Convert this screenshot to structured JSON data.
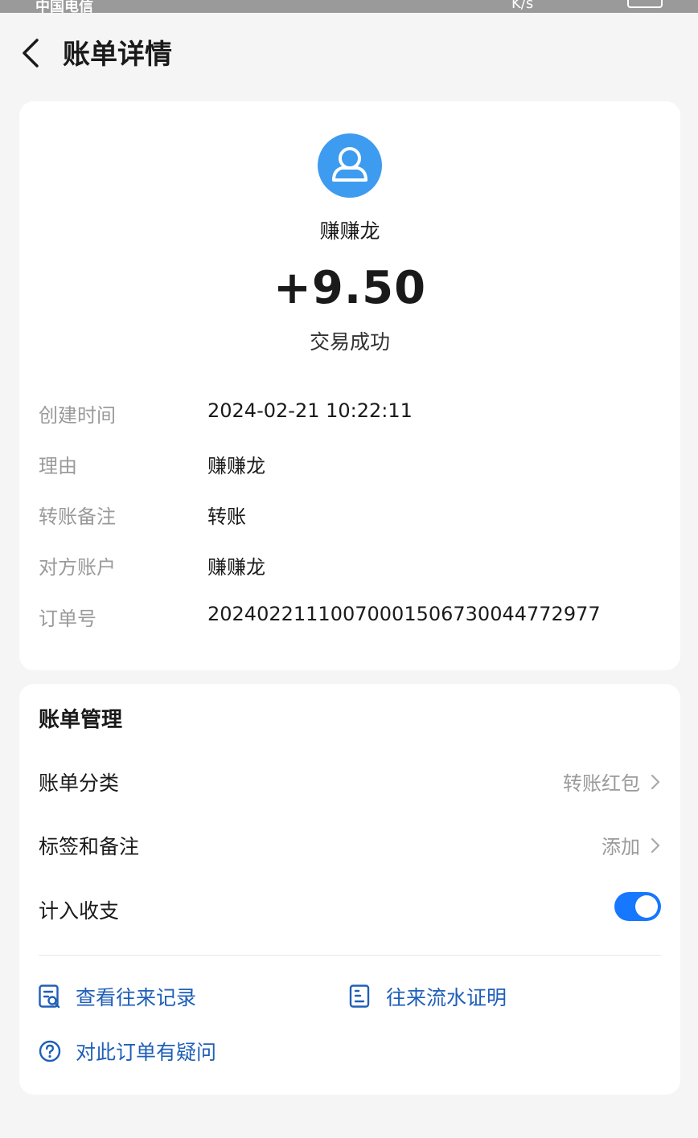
{
  "status_bar": {
    "carrier": "中国电信",
    "network_speed": "K/s"
  },
  "header": {
    "title": "账单详情",
    "back_icon": "chevron-left-icon"
  },
  "transaction": {
    "avatar_icon": "user-avatar-icon",
    "counterparty_name": "赚赚龙",
    "amount": "+9.50",
    "status": "交易成功",
    "details": [
      {
        "label": "创建时间",
        "value": "2024-02-21 10:22:11"
      },
      {
        "label": "理由",
        "value": "赚赚龙"
      },
      {
        "label": "转账备注",
        "value": "转账"
      },
      {
        "label": "对方账户",
        "value": "赚赚龙"
      },
      {
        "label": "订单号",
        "value": "20240221110070001506730044772977"
      }
    ]
  },
  "bill_management": {
    "title": "账单管理",
    "category": {
      "label": "账单分类",
      "value": "转账红包"
    },
    "tags": {
      "label": "标签和备注",
      "value": "添加"
    },
    "include_in_stats": {
      "label": "计入收支",
      "enabled": true
    },
    "links": [
      {
        "label": "查看往来记录",
        "icon": "records-search-icon"
      },
      {
        "label": "往来流水证明",
        "icon": "statement-document-icon"
      },
      {
        "label": "对此订单有疑问",
        "icon": "question-circle-icon"
      }
    ]
  },
  "colors": {
    "accent": "#1677ff",
    "link": "#1f5fb8",
    "background": "#f5f5f5",
    "muted_text": "#9a9a9a"
  }
}
